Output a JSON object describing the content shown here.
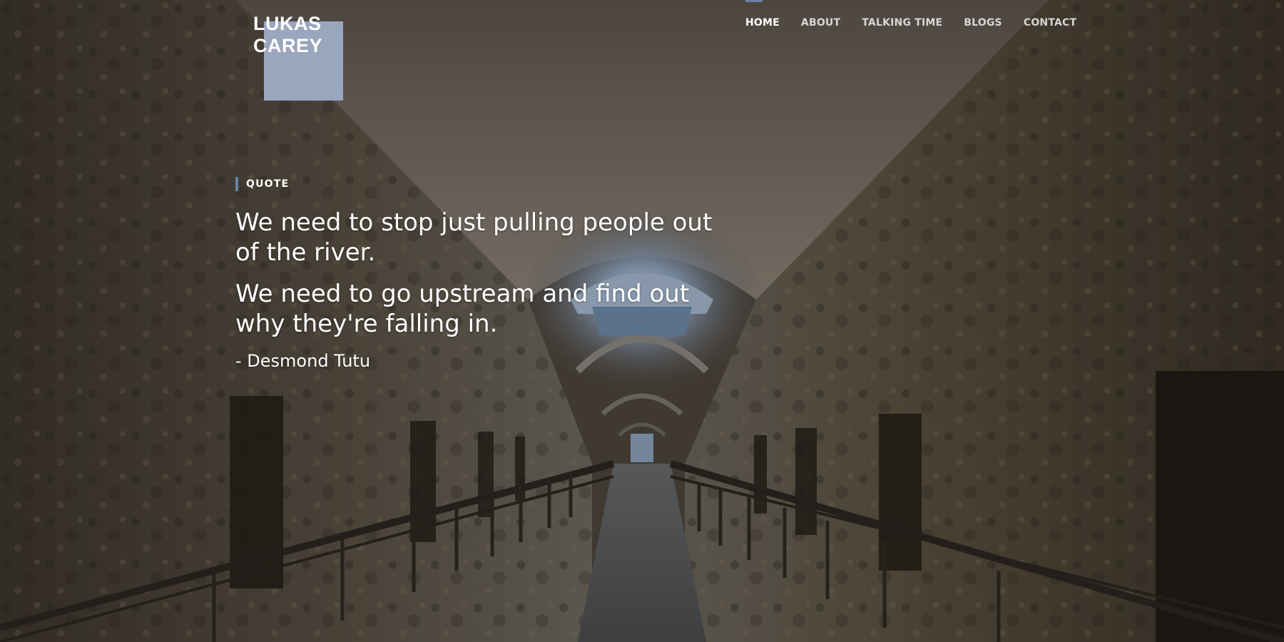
{
  "brand": {
    "name_line1": "LUKAS",
    "name_line2": "CAREY",
    "accent_color": "#9aa6bd"
  },
  "nav": {
    "items": [
      {
        "label": "HOME",
        "active": true
      },
      {
        "label": "ABOUT",
        "active": false
      },
      {
        "label": "TALKING TIME",
        "active": false
      },
      {
        "label": "BLOGS",
        "active": false
      },
      {
        "label": "CONTACT",
        "active": false
      }
    ],
    "indicator_color": "#6b7fa6"
  },
  "hero": {
    "eyebrow": "QUOTE",
    "quote_lines": [
      "We need to stop just pulling people out of the river.",
      "We need to go upstream and find out why they're falling in."
    ],
    "author": "- Desmond Tutu",
    "background": "prison-corridor-photo"
  }
}
